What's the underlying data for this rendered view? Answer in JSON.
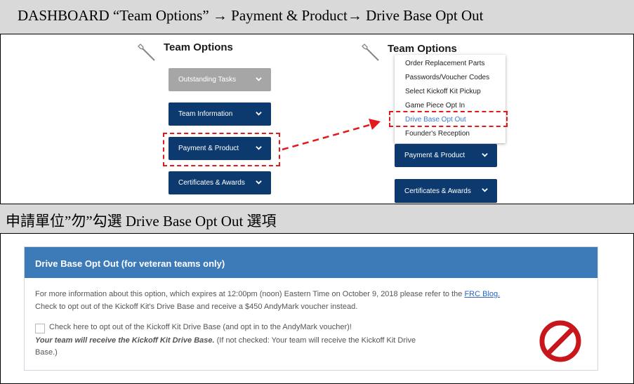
{
  "header1": "DASHBOARD “Team Options”  →  Payment & Product→  Drive Base Opt Out",
  "header2": "申請單位”勿”勾選 Drive Base Opt Out 選項",
  "left_menu": {
    "title": "Team Options",
    "buttons": [
      "Outstanding Tasks",
      "Team Information",
      "Payment & Product",
      "Certificates & Awards"
    ]
  },
  "right_menu": {
    "title": "Team Options",
    "dropdown": [
      "Order Replacement Parts",
      "Passwords/Voucher Codes",
      "Select Kickoff Kit Pickup",
      "Game Piece Opt In",
      "Drive Base Opt Out",
      "Founder's Reception"
    ],
    "buttons": [
      "Payment & Product",
      "Certificates & Awards"
    ]
  },
  "panel": {
    "title": "Drive Base Opt Out (for veteran teams only)",
    "info_line1": "For more information about this option, which expires at 12:00pm (noon) Eastern Time on October 9, 2018 please refer to the",
    "blog_link": "FRC Blog.",
    "info_line2": "Check to opt out of the Kickoff Kit's Drive Base and receive a $450 AndyMark voucher instead.",
    "checkbox_label": "Check here to opt out of the Kickoff Kit Drive Base (and opt in to the AndyMark voucher)!",
    "status_bold": "Your team will receive the Kickoff Kit Drive Base.",
    "status_note_1": "(If not checked: Your team will receive the Kickoff Kit Drive",
    "status_note_2": "Base.)"
  },
  "colors": {
    "button_blue": "#0c3a6e",
    "panel_blue": "#3d7ab8",
    "highlight_red": "#e3191c",
    "header_grey": "#d9d9d9"
  },
  "icons": [
    "wrench-icon",
    "chevron-down-icon",
    "no-sign-icon"
  ]
}
